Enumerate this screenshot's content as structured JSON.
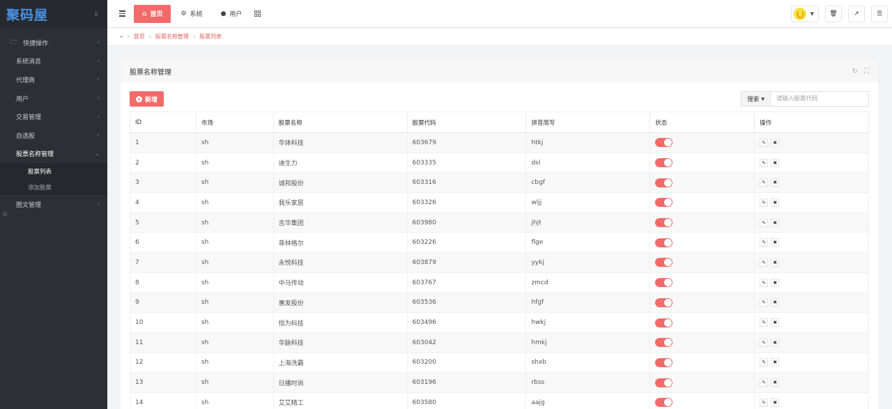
{
  "sidebar": {
    "logo": "聚码屋",
    "items": [
      {
        "label": "快捷操作"
      },
      {
        "label": "系统消息"
      },
      {
        "label": "代理商"
      },
      {
        "label": "用户"
      },
      {
        "label": "交易管理"
      },
      {
        "label": "自选股"
      },
      {
        "label": "股票名称管理"
      },
      {
        "label": "图文管理"
      }
    ],
    "submenu": [
      {
        "label": "股票列表"
      },
      {
        "label": "添加股票"
      }
    ]
  },
  "topbar": {
    "tabs": [
      {
        "label": "首页"
      },
      {
        "label": "系统"
      },
      {
        "label": "用户"
      }
    ]
  },
  "breadcrumb": [
    "首页",
    "股票名称管理",
    "股票列表"
  ],
  "panel": {
    "title": "股票名称管理",
    "add_label": "新增",
    "search_label": "搜索",
    "search_placeholder": "请输入股票代码"
  },
  "table": {
    "headers": [
      "ID",
      "市场",
      "股票名称",
      "股票代码",
      "拼音简写",
      "状态",
      "操作"
    ],
    "rows": [
      [
        "1",
        "sh",
        "华体科技",
        "603679",
        "htkj"
      ],
      [
        "2",
        "sh",
        "迪生力",
        "603335",
        "dsl"
      ],
      [
        "3",
        "sh",
        "诚邦股份",
        "603316",
        "cbgf"
      ],
      [
        "4",
        "sh",
        "我乐家居",
        "603326",
        "wljj"
      ],
      [
        "5",
        "sh",
        "吉华集团",
        "603980",
        "jhjt"
      ],
      [
        "6",
        "sh",
        "菲林格尔",
        "603226",
        "flge"
      ],
      [
        "7",
        "sh",
        "永悦科技",
        "603879",
        "yykj"
      ],
      [
        "8",
        "sh",
        "中马传动",
        "603767",
        "zmcd"
      ],
      [
        "9",
        "sh",
        "惠发股份",
        "603536",
        "hfgf"
      ],
      [
        "10",
        "sh",
        "恒为科技",
        "603496",
        "hwkj"
      ],
      [
        "11",
        "sh",
        "华脉科技",
        "603042",
        "hmkj"
      ],
      [
        "12",
        "sh",
        "上海洗霸",
        "603200",
        "shxb"
      ],
      [
        "13",
        "sh",
        "日播时尚",
        "603196",
        "rbss"
      ],
      [
        "14",
        "sh",
        "艾艾精工",
        "603580",
        "aajg"
      ]
    ]
  },
  "colors": {
    "accent": "#f36a6a",
    "sidebar_bg": "#2c3035",
    "logo": "#4a90e2"
  }
}
